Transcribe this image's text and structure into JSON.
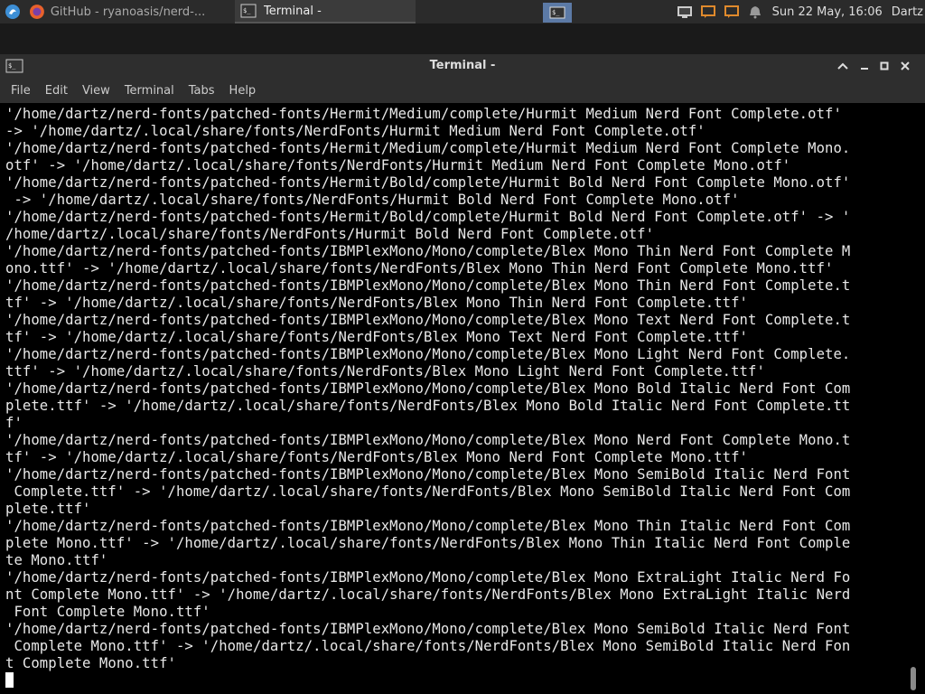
{
  "panel": {
    "tasks": [
      {
        "label": "GitHub - ryanoasis/nerd-...",
        "icon": "firefox-icon"
      },
      {
        "label": "Terminal -",
        "icon": "terminal-icon"
      }
    ],
    "clock": "Sun 22 May, 16:06",
    "user": "Dartz"
  },
  "window": {
    "title": "Terminal -",
    "menu": [
      "File",
      "Edit",
      "View",
      "Terminal",
      "Tabs",
      "Help"
    ]
  },
  "terminal": {
    "lines": [
      "'/home/dartz/nerd-fonts/patched-fonts/Hermit/Medium/complete/Hurmit Medium Nerd Font Complete.otf'",
      "-> '/home/dartz/.local/share/fonts/NerdFonts/Hurmit Medium Nerd Font Complete.otf'",
      "'/home/dartz/nerd-fonts/patched-fonts/Hermit/Medium/complete/Hurmit Medium Nerd Font Complete Mono.",
      "otf' -> '/home/dartz/.local/share/fonts/NerdFonts/Hurmit Medium Nerd Font Complete Mono.otf'",
      "'/home/dartz/nerd-fonts/patched-fonts/Hermit/Bold/complete/Hurmit Bold Nerd Font Complete Mono.otf'",
      " -> '/home/dartz/.local/share/fonts/NerdFonts/Hurmit Bold Nerd Font Complete Mono.otf'",
      "'/home/dartz/nerd-fonts/patched-fonts/Hermit/Bold/complete/Hurmit Bold Nerd Font Complete.otf' -> '",
      "/home/dartz/.local/share/fonts/NerdFonts/Hurmit Bold Nerd Font Complete.otf'",
      "'/home/dartz/nerd-fonts/patched-fonts/IBMPlexMono/Mono/complete/Blex Mono Thin Nerd Font Complete M",
      "ono.ttf' -> '/home/dartz/.local/share/fonts/NerdFonts/Blex Mono Thin Nerd Font Complete Mono.ttf'",
      "'/home/dartz/nerd-fonts/patched-fonts/IBMPlexMono/Mono/complete/Blex Mono Thin Nerd Font Complete.t",
      "tf' -> '/home/dartz/.local/share/fonts/NerdFonts/Blex Mono Thin Nerd Font Complete.ttf'",
      "'/home/dartz/nerd-fonts/patched-fonts/IBMPlexMono/Mono/complete/Blex Mono Text Nerd Font Complete.t",
      "tf' -> '/home/dartz/.local/share/fonts/NerdFonts/Blex Mono Text Nerd Font Complete.ttf'",
      "'/home/dartz/nerd-fonts/patched-fonts/IBMPlexMono/Mono/complete/Blex Mono Light Nerd Font Complete.",
      "ttf' -> '/home/dartz/.local/share/fonts/NerdFonts/Blex Mono Light Nerd Font Complete.ttf'",
      "'/home/dartz/nerd-fonts/patched-fonts/IBMPlexMono/Mono/complete/Blex Mono Bold Italic Nerd Font Com",
      "plete.ttf' -> '/home/dartz/.local/share/fonts/NerdFonts/Blex Mono Bold Italic Nerd Font Complete.tt",
      "f'",
      "'/home/dartz/nerd-fonts/patched-fonts/IBMPlexMono/Mono/complete/Blex Mono Nerd Font Complete Mono.t",
      "tf' -> '/home/dartz/.local/share/fonts/NerdFonts/Blex Mono Nerd Font Complete Mono.ttf'",
      "'/home/dartz/nerd-fonts/patched-fonts/IBMPlexMono/Mono/complete/Blex Mono SemiBold Italic Nerd Font",
      " Complete.ttf' -> '/home/dartz/.local/share/fonts/NerdFonts/Blex Mono SemiBold Italic Nerd Font Com",
      "plete.ttf'",
      "'/home/dartz/nerd-fonts/patched-fonts/IBMPlexMono/Mono/complete/Blex Mono Thin Italic Nerd Font Com",
      "plete Mono.ttf' -> '/home/dartz/.local/share/fonts/NerdFonts/Blex Mono Thin Italic Nerd Font Comple",
      "te Mono.ttf'",
      "'/home/dartz/nerd-fonts/patched-fonts/IBMPlexMono/Mono/complete/Blex Mono ExtraLight Italic Nerd Fo",
      "nt Complete Mono.ttf' -> '/home/dartz/.local/share/fonts/NerdFonts/Blex Mono ExtraLight Italic Nerd",
      " Font Complete Mono.ttf'",
      "'/home/dartz/nerd-fonts/patched-fonts/IBMPlexMono/Mono/complete/Blex Mono SemiBold Italic Nerd Font",
      " Complete Mono.ttf' -> '/home/dartz/.local/share/fonts/NerdFonts/Blex Mono SemiBold Italic Nerd Fon",
      "t Complete Mono.ttf'"
    ]
  },
  "colors": {
    "panel_bg": "#2b2b2b",
    "window_bg": "#2e2e2e",
    "terminal_bg": "#000000",
    "terminal_fg": "#e8e8e8",
    "workspace_active": "#5c7aa6",
    "tray_accent": "#e08a2c"
  }
}
